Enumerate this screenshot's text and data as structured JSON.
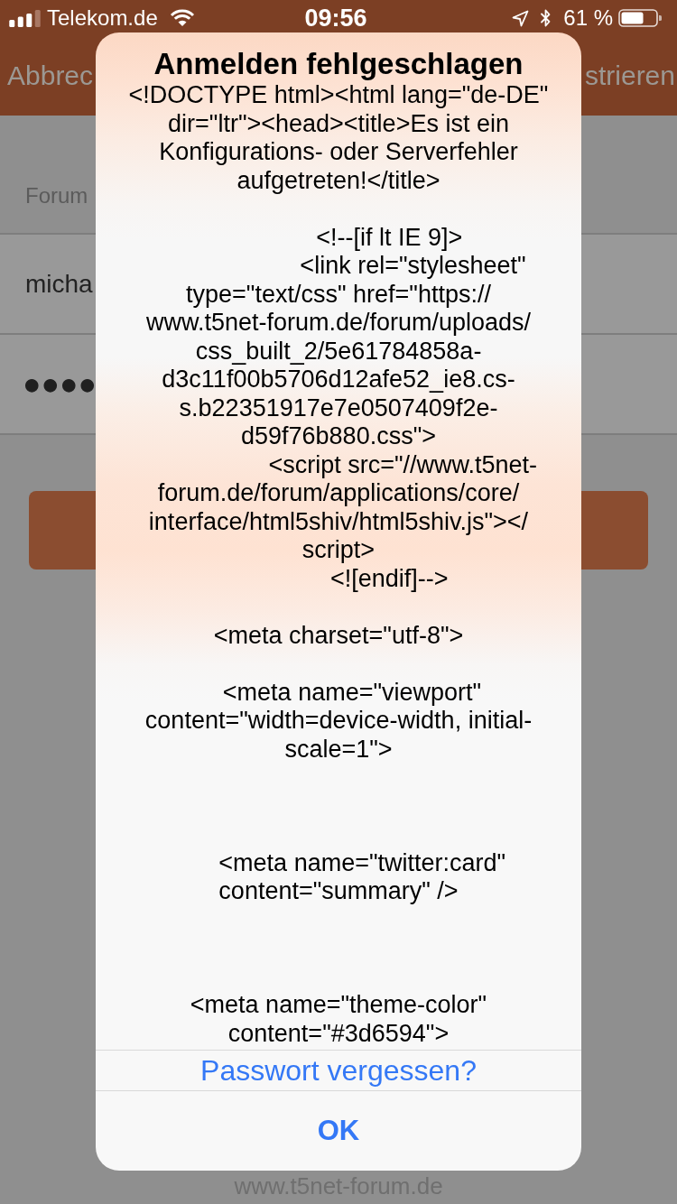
{
  "status_bar": {
    "carrier": "Telekom.de",
    "time": "09:56",
    "battery_percent": "61 %"
  },
  "nav_bar": {
    "left_button": "Abbrec",
    "right_button": "strieren"
  },
  "form": {
    "section_label": "Forum",
    "fields": [
      {
        "kind": "text",
        "value": "micha"
      },
      {
        "kind": "password",
        "value": "●●●●"
      }
    ]
  },
  "alert": {
    "title": "Anmelden fehlgeschlagen",
    "message": "<!DOCTYPE html><html lang=\"de-DE\"\ndir=\"ltr\"><head><title>Es ist ein\nKonfigurations- oder Serverfehler\naufgetreten!</title>\n\n               <!--[if lt IE 9]>\n                      <link rel=\"stylesheet\"\ntype=\"text/css\" href=\"https://\nwww.t5net-forum.de/forum/uploads/\ncss_built_2/5e61784858a-\nd3c11f00b5706d12afe52_ie8.cs-\ns.b22351917e7e0507409f2e-\nd59f76b880.css\">\n                   <script src=\"//www.t5net-\nforum.de/forum/applications/core/\ninterface/html5shiv/html5shiv.js\"></\nscript>\n               <![endif]-->\n\n<meta charset=\"utf-8\">\n\n    <meta name=\"viewport\"\ncontent=\"width=device-width, initial-\nscale=1\">\n\n\n\n       <meta name=\"twitter:card\"\ncontent=\"summary\" />\n\n\n\n<meta name=\"theme-color\"\ncontent=\"#3d6594\">",
    "actions": [
      {
        "kind": "normal",
        "label": "Passwort vergessen?"
      },
      {
        "kind": "preferred",
        "label": "OK"
      }
    ]
  },
  "footer": {
    "link": "www.t5net-forum.de"
  }
}
